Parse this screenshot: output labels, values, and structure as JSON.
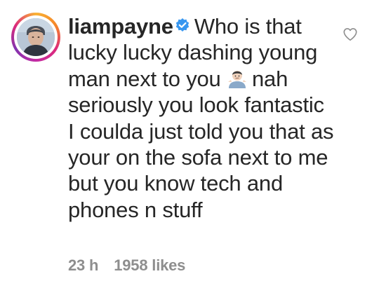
{
  "comment": {
    "username": "liampayne",
    "text_part1": "Who is that lucky lucky dashing young man next to you",
    "text_part2": "nah seriously you look fantastic I coulda just told you that as your on the sofa next to me but you know tech and phones n stuff",
    "emoji": "man-shrugging-emoji",
    "time": "23 h",
    "likes": "1958 likes"
  },
  "icons": {
    "verified": "verified-badge-icon",
    "like": "heart-outline-icon"
  },
  "colors": {
    "text": "#262626",
    "meta": "#8e8e8e",
    "verified": "#3897f0"
  }
}
